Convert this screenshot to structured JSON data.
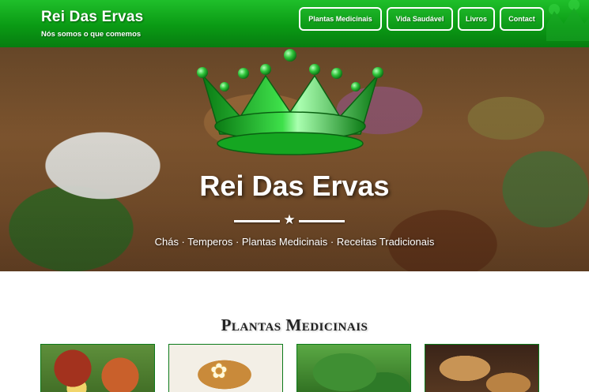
{
  "brand": {
    "title": "Rei Das Ervas",
    "tagline": "Nós somos o que comemos"
  },
  "nav": {
    "items": [
      {
        "label": "Plantas Medicinais"
      },
      {
        "label": "Vida Saudável"
      },
      {
        "label": "Livros"
      },
      {
        "label": "Contact"
      }
    ]
  },
  "hero": {
    "title": "Rei Das Ervas",
    "divider_icon": "star-icon",
    "subtitle": "Chás · Temperos · Plantas Medicinais · Receitas Tradicionais"
  },
  "section": {
    "title": "Plantas Medicinais",
    "cards": [
      {
        "image": "tea-with-lemon-image"
      },
      {
        "image": "chamomile-tea-image"
      },
      {
        "image": "green-leaves-image"
      },
      {
        "image": "ginger-root-image"
      }
    ]
  },
  "colors": {
    "brand_green": "#0a9a14",
    "nav_border": "#ffffff",
    "crown_green": "#22c02c"
  },
  "icons": {
    "crown": "crown-icon"
  }
}
